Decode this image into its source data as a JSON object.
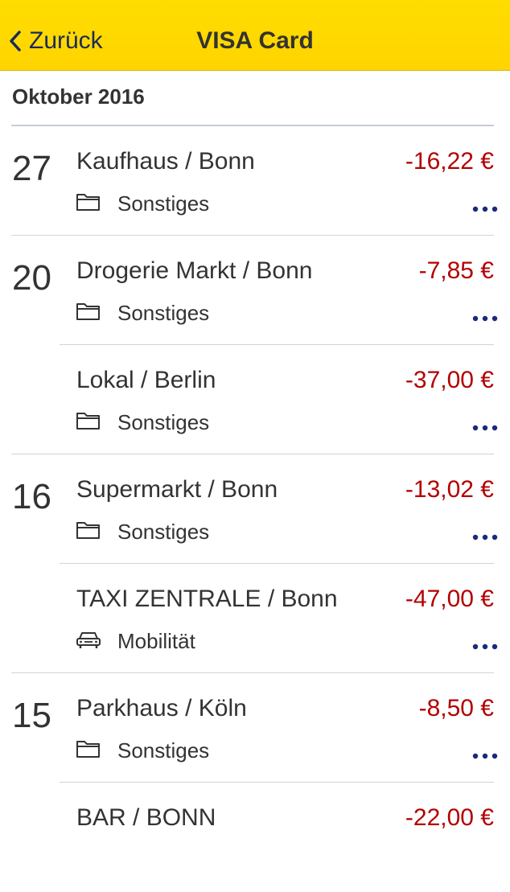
{
  "header": {
    "back_label": "Zurück",
    "title": "VISA Card",
    "background": "#ffd800"
  },
  "month": "Oktober 2016",
  "colors": {
    "amount": "#b30000",
    "more": "#1a2a7a"
  },
  "transactions": [
    {
      "day": "27",
      "merchant": "Kaufhaus / Bonn",
      "amount": "-16,22 €",
      "category": "Sonstiges",
      "category_icon": "folder-icon"
    },
    {
      "day": "20",
      "merchant": "Drogerie Markt / Bonn",
      "amount": "-7,85 €",
      "category": "Sonstiges",
      "category_icon": "folder-icon"
    },
    {
      "day": "",
      "merchant": "Lokal / Berlin",
      "amount": "-37,00 €",
      "category": "Sonstiges",
      "category_icon": "folder-icon"
    },
    {
      "day": "16",
      "merchant": "Supermarkt / Bonn",
      "amount": "-13,02 €",
      "category": "Sonstiges",
      "category_icon": "folder-icon"
    },
    {
      "day": "",
      "merchant": "TAXI ZENTRALE / Bonn",
      "amount": "-47,00 €",
      "category": "Mobilität",
      "category_icon": "car-icon"
    },
    {
      "day": "15",
      "merchant": "Parkhaus / Köln",
      "amount": "-8,50 €",
      "category": "Sonstiges",
      "category_icon": "folder-icon"
    },
    {
      "day": "",
      "merchant": "BAR / BONN",
      "amount": "-22,00 €",
      "category": "",
      "category_icon": ""
    }
  ]
}
